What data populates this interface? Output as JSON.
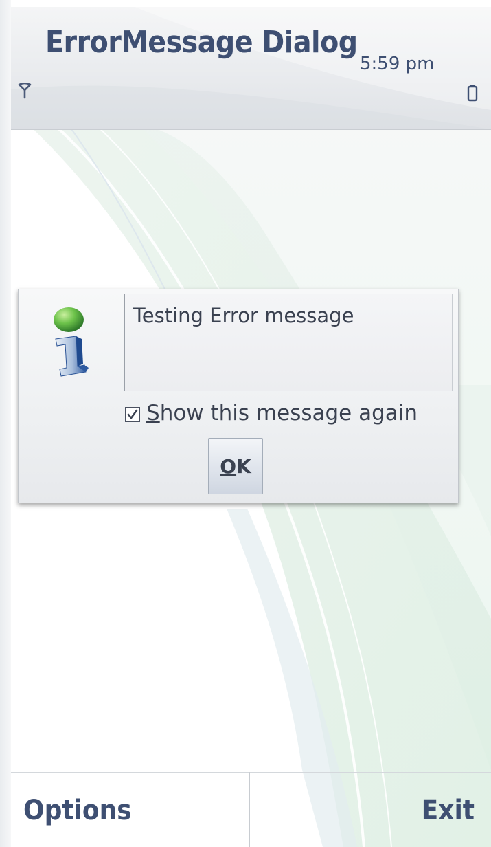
{
  "status_pane": {
    "title": "ErrorMessage Dialog",
    "time": "5:59 pm",
    "signal_icon": "signal-antenna-icon",
    "battery_icon": "battery-icon"
  },
  "dialog": {
    "icon": "info-icon",
    "message": "Testing Error message",
    "checkbox": {
      "checked": true,
      "label_mnemonic": "S",
      "label_rest": "how this message again"
    },
    "ok_button": {
      "label_mnemonic": "O",
      "label_rest": "K"
    }
  },
  "softkeys": {
    "left": "Options",
    "right": "Exit"
  },
  "colors": {
    "text_accent": "#3e4f72",
    "dialog_text": "#3a4150"
  }
}
